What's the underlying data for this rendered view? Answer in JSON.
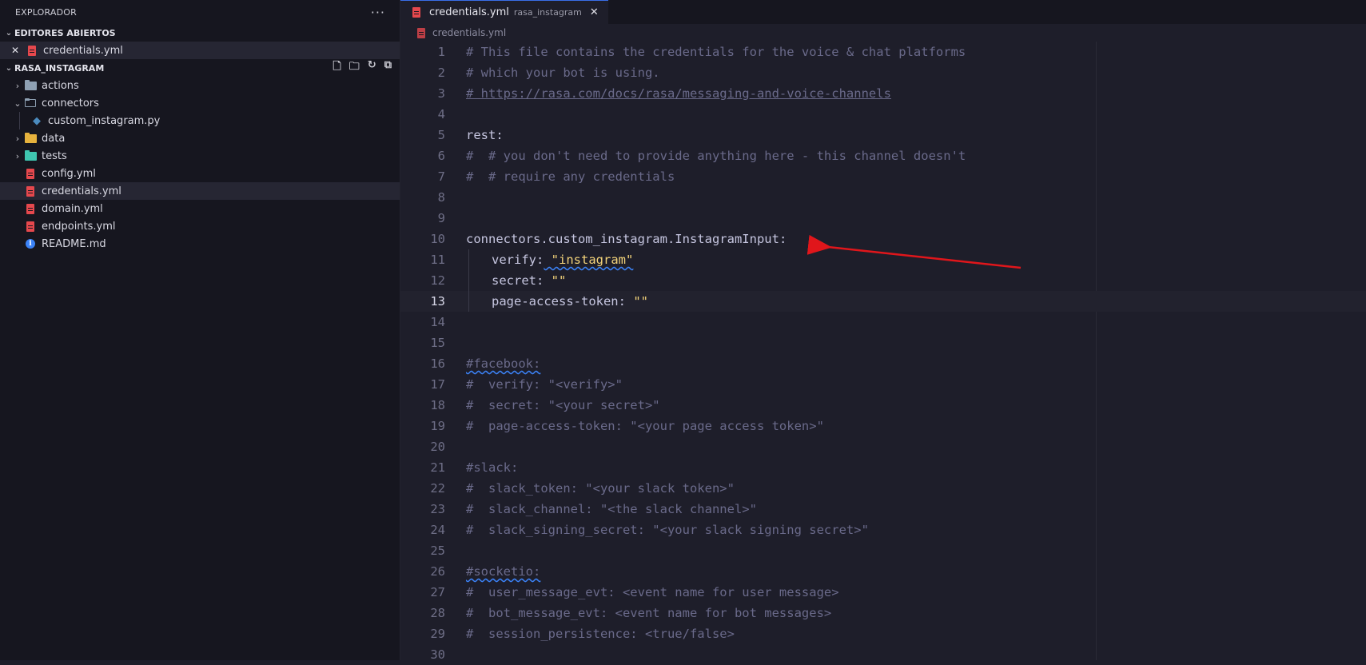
{
  "sidebar": {
    "title": "EXPLORADOR",
    "more": "···",
    "open_editors": {
      "label": "EDITORES ABIERTOS",
      "items": [
        {
          "name": "credentials.yml"
        }
      ]
    },
    "project": {
      "label": "RASA_INSTAGRAM",
      "tree": [
        {
          "name": "actions"
        },
        {
          "name": "connectors"
        },
        {
          "name": "custom_instagram.py"
        },
        {
          "name": "data"
        },
        {
          "name": "tests"
        },
        {
          "name": "config.yml"
        },
        {
          "name": "credentials.yml"
        },
        {
          "name": "domain.yml"
        },
        {
          "name": "endpoints.yml"
        },
        {
          "name": "README.md"
        }
      ]
    }
  },
  "editor": {
    "tab": {
      "label": "credentials.yml",
      "sub": "rasa_instagram",
      "close": "✕"
    },
    "breadcrumb": "credentials.yml",
    "current_line": 13,
    "lines": [
      "# This file contains the credentials for the voice & chat platforms",
      "# which your bot is using.",
      "# https://rasa.com/docs/rasa/messaging-and-voice-channels",
      "",
      "rest:",
      "#  # you don't need to provide anything here - this channel doesn't",
      "#  # require any credentials",
      "",
      "",
      "connectors.custom_instagram.InstagramInput:",
      "verify: \"instagram\"",
      "secret: \"\"",
      "page-access-token: \"\"",
      "",
      "",
      "#facebook:",
      "#  verify: \"<verify>\"",
      "#  secret: \"<your secret>\"",
      "#  page-access-token: \"<your page access token>\"",
      "",
      "#slack:",
      "#  slack_token: \"<your slack token>\"",
      "#  slack_channel: \"<the slack channel>\"",
      "#  slack_signing_secret: \"<your slack signing secret>\"",
      "",
      "#socketio:",
      "#  user_message_evt: <event name for user message>",
      "#  bot_message_evt: <event name for bot messages>",
      "#  session_persistence: <true/false>",
      ""
    ]
  },
  "colors": {
    "annotation_arrow": "#e0161b",
    "string": "#f3d37a",
    "comment": "#6a6a8a"
  }
}
